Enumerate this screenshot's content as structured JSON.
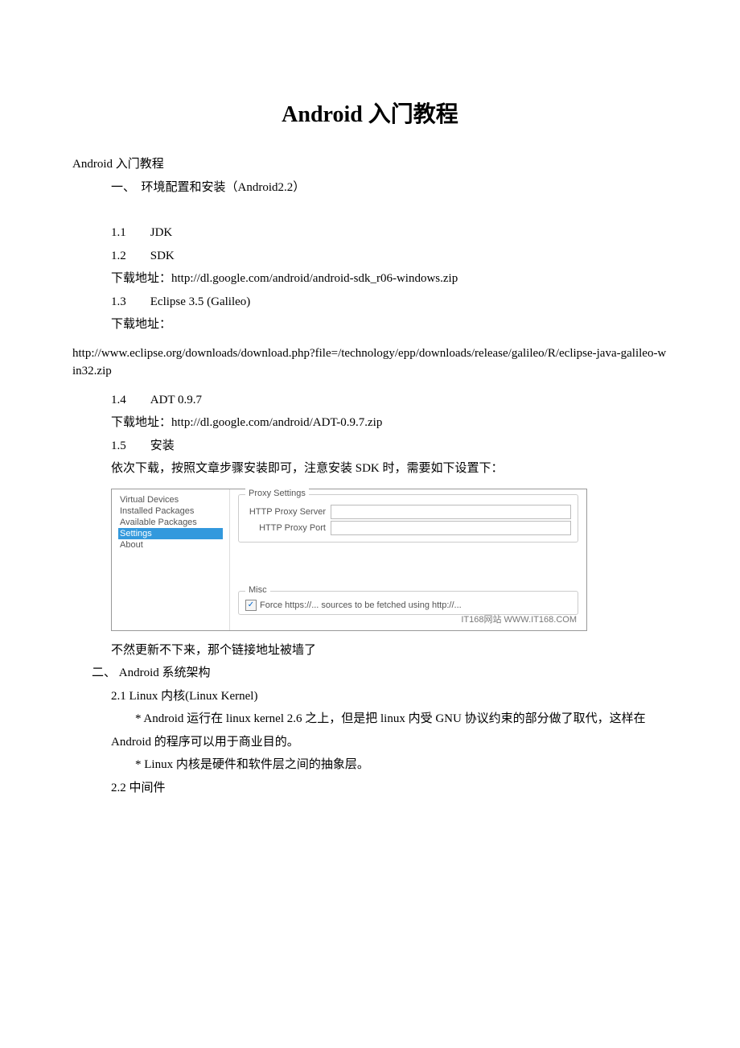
{
  "title": "Android 入门教程",
  "subtitle": "Android 入门教程",
  "section1": {
    "heading": "一、　环境配置和安装（Android2.2）",
    "items": {
      "jdk": "1.1　　JDK",
      "sdk": "1.2　　SDK",
      "sdk_url_label": "下载地址：http://dl.google.com/android/android-sdk_r06-windows.zip",
      "eclipse": "1.3　　Eclipse 3.5 (Galileo)",
      "eclipse_url_label": "下载地址：",
      "eclipse_url": "http://www.eclipse.org/downloads/download.php?file=/technology/epp/downloads/release/galileo/R/eclipse-java-galileo-win32.zip",
      "adt": "1.4　　ADT 0.9.7",
      "adt_url": "下载地址：http://dl.google.com/android/ADT-0.9.7.zip",
      "install": "1.5　　安装",
      "install_note": "依次下载，按照文章步骤安装即可，注意安装 SDK 时，需要如下设置下："
    }
  },
  "screenshot": {
    "left_items": [
      "Virtual Devices",
      "Installed Packages",
      "Available Packages",
      "Settings",
      "About"
    ],
    "proxy_title": "Proxy Settings",
    "proxy_server_label": "HTTP Proxy Server",
    "proxy_port_label": "HTTP Proxy Port",
    "misc_title": "Misc",
    "checkbox_label": "Force https://... sources to be fetched using http://...",
    "watermark": "IT168网站 WWW.IT168.COM"
  },
  "after_screenshot": "不然更新不下来，那个链接地址被墙了",
  "section2": {
    "heading": "二、 Android 系统架构",
    "s21": "2.1 Linux 内核(Linux Kernel)",
    "s21_p1": "　　* Android 运行在 linux kernel 2.6 之上，但是把 linux 内受 GNU 协议约束的部分做了取代，这样在 Android 的程序可以用于商业目的。",
    "s21_p2": "　　* Linux 内核是硬件和软件层之间的抽象层。",
    "s22": "2.2 中间件"
  }
}
